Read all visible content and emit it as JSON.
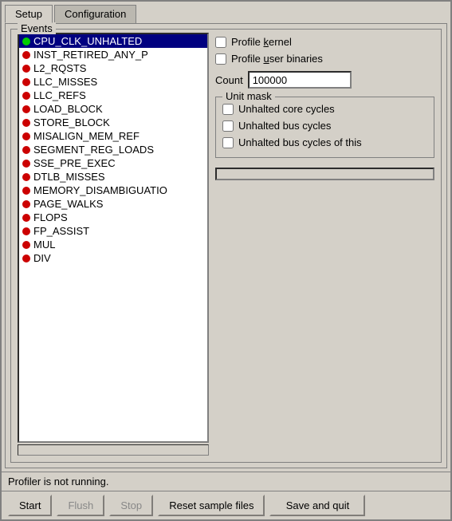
{
  "tabs": [
    {
      "id": "setup",
      "label": "Setup",
      "active": true
    },
    {
      "id": "configuration",
      "label": "Configuration",
      "active": false
    }
  ],
  "events_group_label": "Events",
  "events": [
    {
      "id": "CPU_CLK_UNHALTED",
      "label": "CPU_CLK_UNHALTED",
      "color": "green",
      "selected": true
    },
    {
      "id": "INST_RETIRED_ANY_P",
      "label": "INST_RETIRED_ANY_P",
      "color": "red",
      "selected": false
    },
    {
      "id": "L2_RQSTS",
      "label": "L2_RQSTS",
      "color": "red",
      "selected": false
    },
    {
      "id": "LLC_MISSES",
      "label": "LLC_MISSES",
      "color": "red",
      "selected": false
    },
    {
      "id": "LLC_REFS",
      "label": "LLC_REFS",
      "color": "red",
      "selected": false
    },
    {
      "id": "LOAD_BLOCK",
      "label": "LOAD_BLOCK",
      "color": "red",
      "selected": false
    },
    {
      "id": "STORE_BLOCK",
      "label": "STORE_BLOCK",
      "color": "red",
      "selected": false
    },
    {
      "id": "MISALIGN_MEM_REF",
      "label": "MISALIGN_MEM_REF",
      "color": "red",
      "selected": false
    },
    {
      "id": "SEGMENT_REG_LOADS",
      "label": "SEGMENT_REG_LOADS",
      "color": "red",
      "selected": false
    },
    {
      "id": "SSE_PRE_EXEC",
      "label": "SSE_PRE_EXEC",
      "color": "red",
      "selected": false
    },
    {
      "id": "DTLB_MISSES",
      "label": "DTLB_MISSES",
      "color": "red",
      "selected": false
    },
    {
      "id": "MEMORY_DISAMBIGUATIO",
      "label": "MEMORY_DISAMBIGUATIO",
      "color": "red",
      "selected": false
    },
    {
      "id": "PAGE_WALKS",
      "label": "PAGE_WALKS",
      "color": "red",
      "selected": false
    },
    {
      "id": "FLOPS",
      "label": "FLOPS",
      "color": "red",
      "selected": false
    },
    {
      "id": "FP_ASSIST",
      "label": "FP_ASSIST",
      "color": "red",
      "selected": false
    },
    {
      "id": "MUL",
      "label": "MUL",
      "color": "red",
      "selected": false
    },
    {
      "id": "DIV",
      "label": "DIV",
      "color": "red",
      "selected": false
    }
  ],
  "profile_kernel_label": "Profile kernel",
  "profile_kernel_checked": false,
  "profile_user_label": "Profile user binaries",
  "profile_user_checked": false,
  "count_label": "Count",
  "count_value": "100000",
  "unit_mask_label": "Unit mask",
  "unit_mask_items": [
    {
      "id": "unhalted_core",
      "label": "Unhalted core cycles",
      "checked": false
    },
    {
      "id": "unhalted_bus",
      "label": "Unhalted bus cycles",
      "checked": false
    },
    {
      "id": "unhalted_bus_of_this",
      "label": "Unhalted bus cycles of this",
      "checked": false
    }
  ],
  "status_text": "Profiler is not running.",
  "buttons": {
    "start": "Start",
    "flush": "Flush",
    "stop": "Stop",
    "reset": "Reset sample files",
    "save_quit": "Save and quit"
  }
}
